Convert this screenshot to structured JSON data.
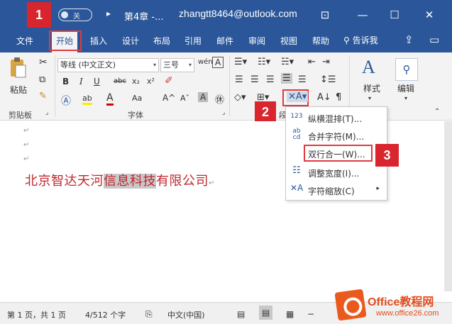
{
  "titlebar": {
    "callout": "1",
    "autosave_label": "关",
    "document_title": "第4章 -...",
    "user": "zhangtt8464@outlook.com"
  },
  "menubar": {
    "tabs": [
      "文件",
      "开始",
      "插入",
      "设计",
      "布局",
      "引用",
      "邮件",
      "审阅",
      "视图",
      "帮助"
    ],
    "tell_me": "告诉我"
  },
  "ribbon": {
    "clipboard": {
      "paste_label": "粘贴",
      "group_label": "剪贴板"
    },
    "font": {
      "font_name": "等线 (中文正文)",
      "font_size": "三号",
      "group_label": "字体"
    },
    "paragraph": {
      "group_label": "段"
    },
    "styles": {
      "label": "样式"
    },
    "editing": {
      "label": "编辑"
    },
    "callout_2": "2",
    "callout_3": "3"
  },
  "dropdown": {
    "items": [
      {
        "icon": "vertical-horizontal-mixed-icon",
        "label": "纵横混排(T)..."
      },
      {
        "icon": "combine-characters-icon",
        "label": "合并字符(M)..."
      },
      {
        "icon": "two-lines-in-one-icon",
        "label": "双行合一(W)..."
      },
      {
        "icon": "fit-text-icon",
        "label": "调整宽度(I)..."
      },
      {
        "icon": "character-scaling-icon",
        "label": "字符缩放(C)"
      }
    ]
  },
  "document": {
    "text_before": "北京智达天河",
    "text_highlight": "信息科技",
    "text_after": "有限公司"
  },
  "statusbar": {
    "page": "第 1 页，共 1 页",
    "words": "4/512 个字",
    "language": "中文(中国)"
  },
  "watermark": {
    "title": "Office教程网",
    "url": "www.office26.com"
  },
  "colors": {
    "ribbon_blue": "#2b579a",
    "callout_red": "#d9252d",
    "text_red": "#c0262d"
  }
}
